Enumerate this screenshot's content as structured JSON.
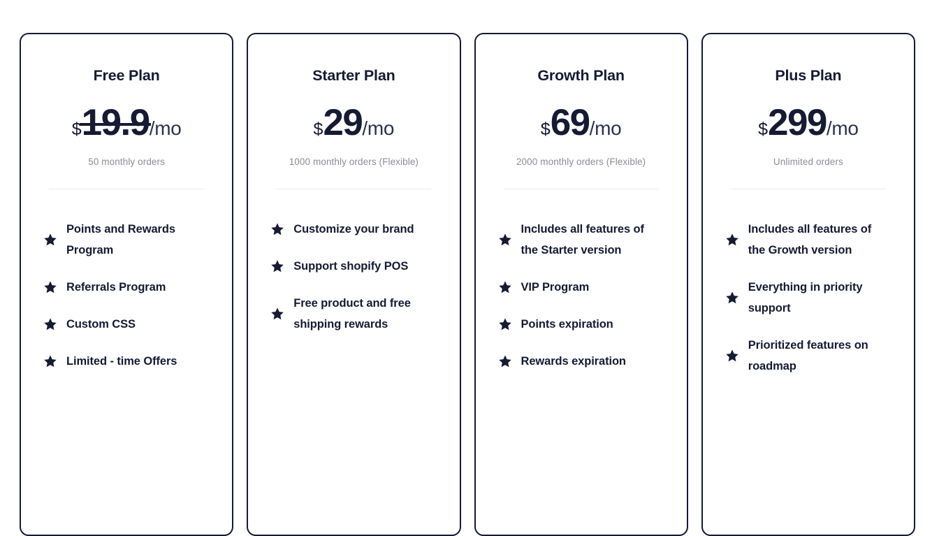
{
  "page": {
    "background_color": "#ffffff",
    "accent_color": "#161b33",
    "muted_text_color": "#8c8c99",
    "divider_color": "#e9e9ee",
    "star_icon": "star-icon"
  },
  "plans": [
    {
      "title": "Free Plan",
      "currency": "$",
      "amount": "19.9",
      "amount_struck": true,
      "period": "/mo",
      "orders_note": "50 monthly orders",
      "features": [
        "Points and Rewards Program",
        "Referrals Program",
        "Custom CSS",
        "Limited - time Offers"
      ]
    },
    {
      "title": "Starter Plan",
      "currency": "$",
      "amount": "29",
      "amount_struck": false,
      "period": "/mo",
      "orders_note": "1000 monthly orders (Flexible)",
      "features": [
        "Customize your brand",
        "Support shopify POS",
        "Free product and free shipping rewards"
      ]
    },
    {
      "title": "Growth Plan",
      "currency": "$",
      "amount": "69",
      "amount_struck": false,
      "period": "/mo",
      "orders_note": "2000 monthly orders (Flexible)",
      "features": [
        "Includes all features of the Starter version",
        "VIP Program",
        "Points expiration",
        "Rewards expiration"
      ]
    },
    {
      "title": "Plus Plan",
      "currency": "$",
      "amount": "299",
      "amount_struck": false,
      "period": "/mo",
      "orders_note": "Unlimited orders",
      "features": [
        "Includes all features of the Growth version",
        "Everything in priority support",
        "Prioritized features on roadmap"
      ]
    }
  ]
}
